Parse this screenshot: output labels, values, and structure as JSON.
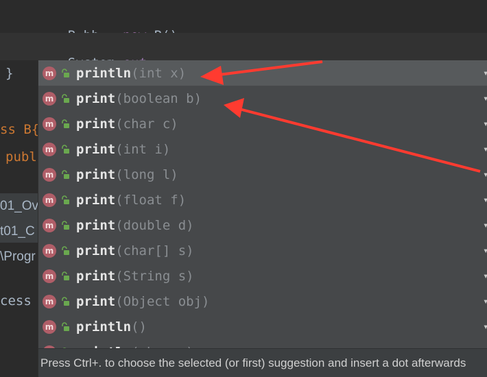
{
  "editor": {
    "line1": {
      "type": "B",
      "var": "bb",
      "eq": " = ",
      "kw_new": "new",
      "ctor": " B();"
    },
    "line2": {
      "cls": "System.",
      "field": "out",
      "dot": "."
    },
    "left_fragments": [
      "}",
      "ss B{",
      "publ",
      "01_Ov",
      "t01_C",
      "\\Progr",
      "cess"
    ]
  },
  "completion": {
    "items": [
      {
        "name": "println",
        "params": "(int x)"
      },
      {
        "name": "print",
        "params": "(boolean b)"
      },
      {
        "name": "print",
        "params": "(char c)"
      },
      {
        "name": "print",
        "params": "(int i)"
      },
      {
        "name": "print",
        "params": "(long l)"
      },
      {
        "name": "print",
        "params": "(float f)"
      },
      {
        "name": "print",
        "params": "(double d)"
      },
      {
        "name": "print",
        "params": "(char[] s)"
      },
      {
        "name": "print",
        "params": "(String s)"
      },
      {
        "name": "print",
        "params": "(Object obj)"
      },
      {
        "name": "println",
        "params": "()"
      },
      {
        "name": "println",
        "params": "(char x)"
      }
    ],
    "selected_index": 0,
    "icon_letter": "m",
    "hint": "Press Ctrl+. to choose the selected (or first) suggestion and insert a dot afterwards"
  },
  "colors": {
    "background": "#2b2b2b",
    "popup": "#46484a",
    "selected": "#575a5c",
    "method_icon": "#b05e68",
    "annotation_arrow": "#ff3b30"
  }
}
